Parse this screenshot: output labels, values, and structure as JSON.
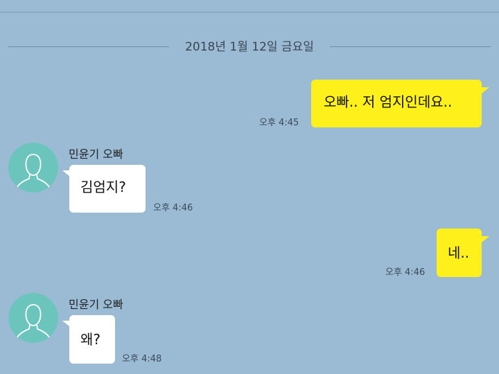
{
  "date_separator": "2018년 1월 12일 금요일",
  "messages": [
    {
      "from": "me",
      "text": "오빠.. 저 엄지인데요..",
      "time": "오후 4:45"
    },
    {
      "from": "other",
      "sender": "민윤기 오빠",
      "text": "김엄지?",
      "time": "오후 4:46",
      "avatar_icon": "person-silhouette-icon"
    },
    {
      "from": "me",
      "text": "네..",
      "time": "오후 4:46"
    },
    {
      "from": "other",
      "sender": "민윤기 오빠",
      "text": "왜?",
      "time": "오후 4:48",
      "avatar_icon": "person-silhouette-icon"
    }
  ],
  "colors": {
    "background": "#9bbbd4",
    "my_bubble": "#fef01b",
    "other_bubble": "#ffffff",
    "avatar": "#6cc5bd"
  }
}
